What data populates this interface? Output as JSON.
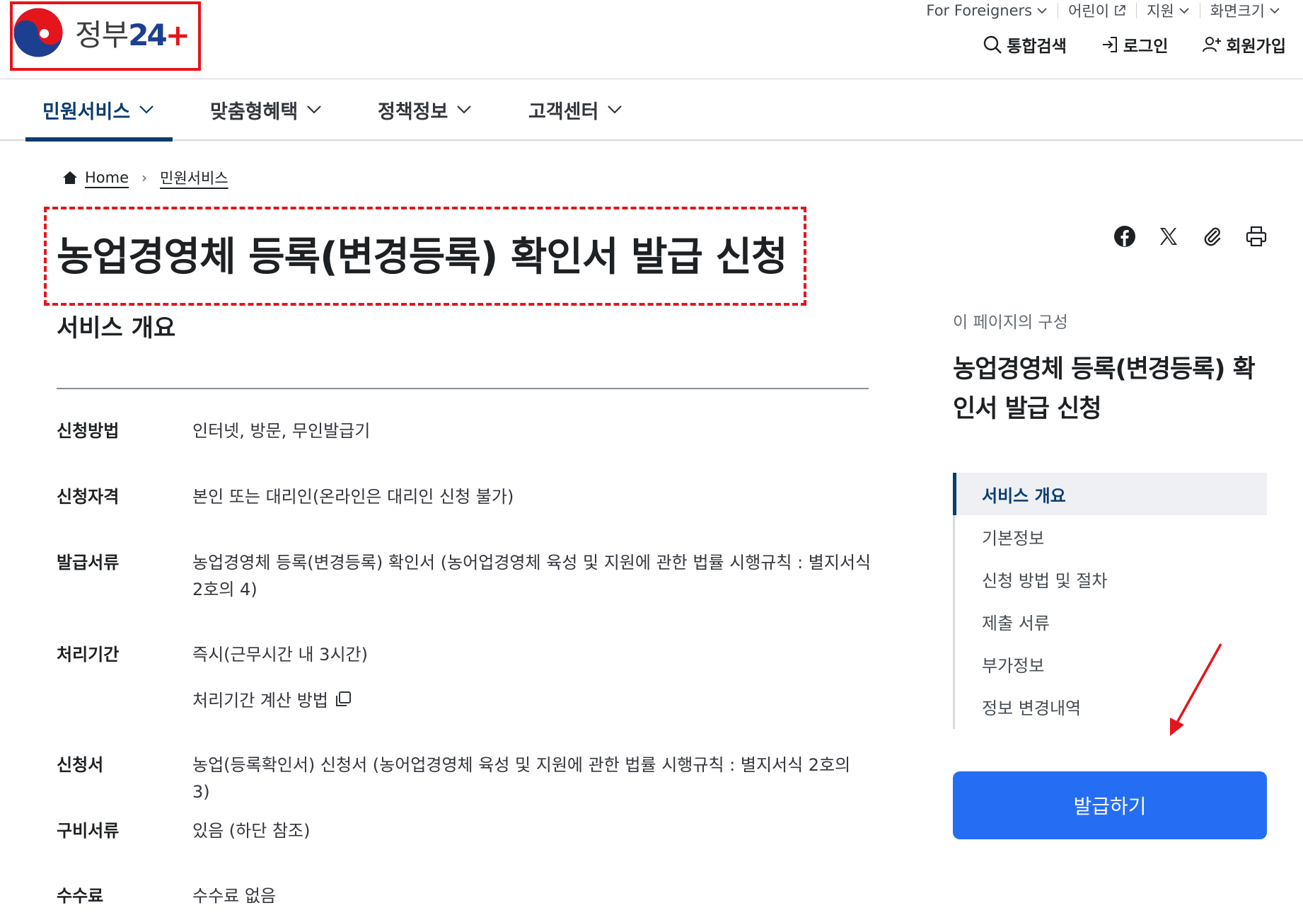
{
  "header": {
    "logo": {
      "text": "정부",
      "num": "24",
      "plus": "+"
    },
    "util_nav": [
      {
        "label": "For Foreigners",
        "icon": "chevron-down-icon"
      },
      {
        "label": "어린이",
        "icon": "external-link-icon"
      },
      {
        "label": "지원",
        "icon": "chevron-down-icon"
      },
      {
        "label": "화면크기",
        "icon": "chevron-down-icon"
      }
    ],
    "member_nav": [
      {
        "label": "통합검색",
        "icon": "search-icon"
      },
      {
        "label": "로그인",
        "icon": "login-icon"
      },
      {
        "label": "회원가입",
        "icon": "user-add-icon"
      }
    ]
  },
  "gnb": [
    {
      "label": "민원서비스",
      "active": true
    },
    {
      "label": "맞춤형혜택",
      "active": false
    },
    {
      "label": "정책정보",
      "active": false
    },
    {
      "label": "고객센터",
      "active": false
    }
  ],
  "breadcrumb": {
    "home": "Home",
    "current": "민원서비스"
  },
  "page": {
    "title": "농업경영체 등록(변경등록) 확인서 발급 신청"
  },
  "share": [
    "facebook-icon",
    "x-icon",
    "link-icon",
    "print-icon"
  ],
  "overview": {
    "title": "서비스 개요",
    "rows": [
      {
        "label": "신청방법",
        "value": "인터넷, 방문, 무인발급기"
      },
      {
        "label": "신청자격",
        "value": "본인 또는 대리인(온라인은 대리인 신청 불가)"
      },
      {
        "label": "발급서류",
        "value": "농업경영체 등록(변경등록) 확인서 (농어업경영체 육성 및 지원에 관한 법률 시행규칙 : 별지서식 2호의 4)"
      },
      {
        "label": "처리기간",
        "value": "즉시(근무시간 내 3시간)"
      },
      {
        "label": "신청서",
        "value": "농업(등록확인서) 신청서 (농어업경영체 육성 및 지원에 관한 법률 시행규칙 : 별지서식 2호의 3)"
      },
      {
        "label": "구비서류",
        "value": "있음 (하단 참조)"
      },
      {
        "label": "수수료",
        "value": "수수료 없음"
      }
    ],
    "calc_link": "처리기간 계산 방법"
  },
  "sidebar": {
    "caption": "이 페이지의 구성",
    "heading": "농업경영체 등록(변경등록) 확인서 발급 신청",
    "toc": [
      {
        "label": "서비스 개요",
        "active": true
      },
      {
        "label": "기본정보",
        "active": false
      },
      {
        "label": "신청 방법 및 절차",
        "active": false
      },
      {
        "label": "제출 서류",
        "active": false
      },
      {
        "label": "부가정보",
        "active": false
      },
      {
        "label": "정보 변경내역",
        "active": false
      }
    ],
    "issue_button": "발급하기"
  },
  "colors": {
    "primary_navy": "#0b3c6e",
    "button_blue": "#256ef4",
    "annotation_red": "#e4161b"
  }
}
